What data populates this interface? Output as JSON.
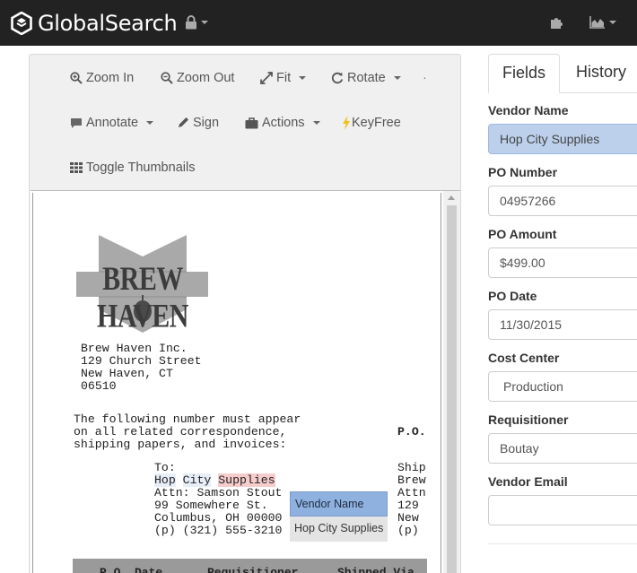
{
  "app": {
    "brand": "GlobalSearch"
  },
  "toolbar": {
    "zoom_in": "Zoom In",
    "zoom_out": "Zoom Out",
    "fit": "Fit",
    "rotate": "Rotate",
    "annotate": "Annotate",
    "sign": "Sign",
    "actions": "Actions",
    "keyfree": "KeyFree",
    "toggle_thumbnails": "Toggle Thumbnails"
  },
  "document": {
    "logo_text": "BREW HAVEN",
    "sender": [
      "Brew Haven Inc.",
      "129 Church Street",
      "New Haven, CT",
      "06510"
    ],
    "notice": [
      "The following number must appear",
      "on all related correspondence,",
      "shipping papers, and invoices:"
    ],
    "po_label": "P.O.",
    "to_label": "To:",
    "vendor_word1": "Hop",
    "vendor_word2": "City",
    "vendor_word3": "Supplies",
    "to_address": [
      "Attn: Samson Stout",
      "99 Somewhere St.",
      "Columbus, OH 00000",
      "(p) (321) 555-3210"
    ],
    "ship_cut": [
      "Ship",
      "Brew",
      "Attn",
      "129",
      "New",
      "(p)"
    ],
    "table_headers": [
      "P.O. Date",
      "Requisitioner",
      "Shipped Via"
    ]
  },
  "tooltip": {
    "title": "Vendor Name",
    "value": "Hop City Supplies"
  },
  "tabs": {
    "fields": "Fields",
    "history": "History"
  },
  "fields": {
    "vendor_name": {
      "label": "Vendor Name",
      "value": "Hop City Supplies"
    },
    "po_number": {
      "label": "PO Number",
      "value": "04957266"
    },
    "po_amount": {
      "label": "PO Amount",
      "value": "$499.00"
    },
    "po_date": {
      "label": "PO Date",
      "value": "11/30/2015"
    },
    "cost_center": {
      "label": "Cost Center",
      "value": "Production"
    },
    "requisitioner": {
      "label": "Requisitioner",
      "value": "Boutay"
    },
    "vendor_email": {
      "label": "Vendor Email",
      "value": ""
    }
  },
  "colors": {
    "navbar": "#222222",
    "highlight_field": "#bcd0ec",
    "tooltip_head": "#8fb1e0",
    "vendor_highlight": "#f6cccc"
  },
  "icons": [
    "globalsearch-logo-icon",
    "lock-icon",
    "puzzle-icon",
    "area-chart-icon",
    "zoom-in-icon",
    "zoom-out-icon",
    "expand-icon",
    "rotate-icon",
    "comment-icon",
    "pencil-icon",
    "briefcase-icon",
    "lightning-icon",
    "grid-icon"
  ]
}
